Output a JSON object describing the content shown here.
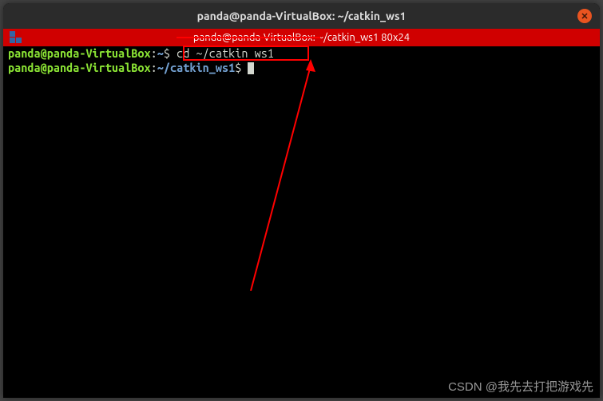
{
  "titlebar": {
    "title": "panda@panda-VirtualBox: ~/catkin_ws1"
  },
  "redbar": {
    "text": "panda@panda-VirtualBox: ~/catkin_ws1 80x24"
  },
  "terminal": {
    "line1_userhost": "panda@panda-VirtualBox",
    "line1_colon": ":",
    "line1_path": "~",
    "line1_dollar": "$ ",
    "line1_cmd": "cd ~/catkin_ws1",
    "line2_userhost": "panda@panda-VirtualBox",
    "line2_colon": ":",
    "line2_path": "~/catkin_ws1",
    "line2_dollar": "$ "
  },
  "watermark": "CSDN @我先去打把游戏先"
}
